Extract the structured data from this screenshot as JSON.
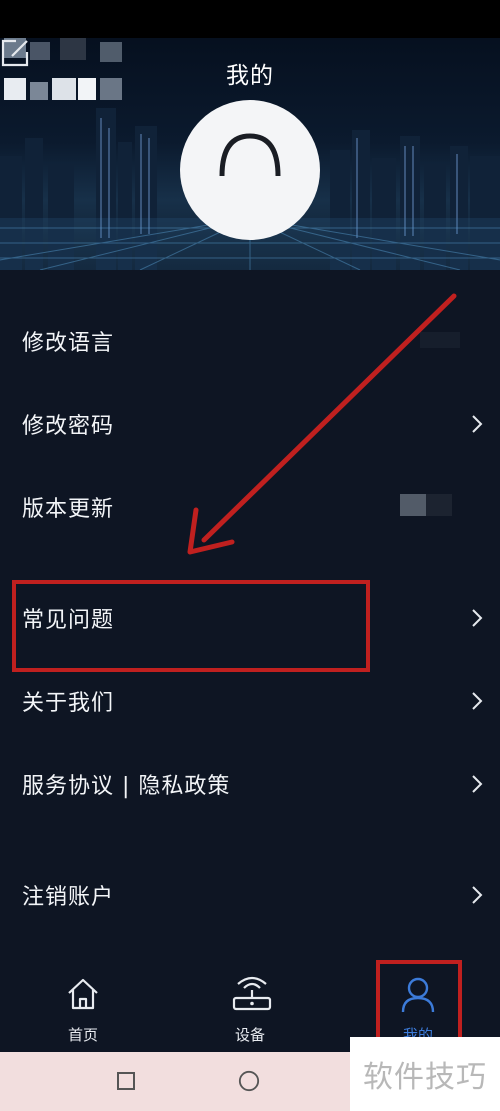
{
  "header": {
    "title": "我的"
  },
  "menu": {
    "items": [
      {
        "label": "修改语言"
      },
      {
        "label": "修改密码"
      },
      {
        "label": "版本更新"
      },
      {
        "label": "常见问题"
      },
      {
        "label": "关于我们"
      },
      {
        "label": "服务协议 | 隐私政策"
      },
      {
        "label": "注销账户"
      }
    ]
  },
  "tabbar": {
    "tabs": [
      {
        "label": "首页",
        "icon": "home-icon"
      },
      {
        "label": "设备",
        "icon": "router-icon"
      },
      {
        "label": "我的",
        "icon": "user-icon",
        "active": true
      }
    ]
  },
  "watermark": {
    "text": "软件技巧"
  },
  "colors": {
    "background": "#0e1523",
    "accent": "#3c7bd9",
    "annotation": "#c0201f"
  }
}
